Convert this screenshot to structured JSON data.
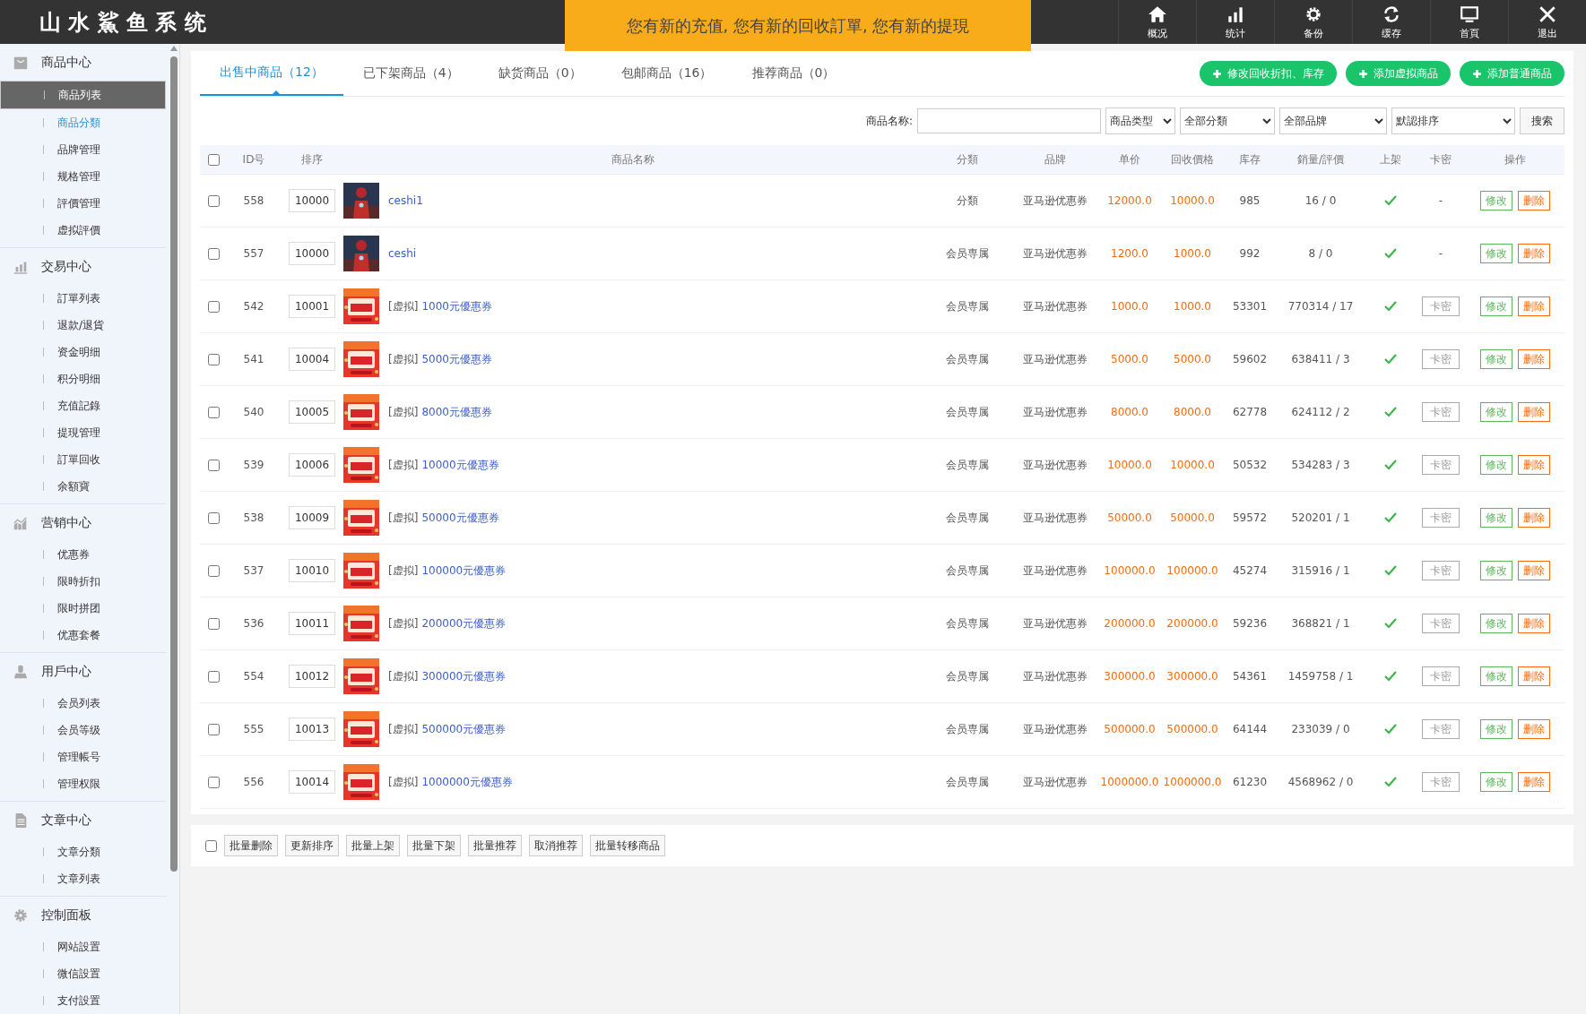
{
  "header": {
    "title": "山 水 鯊 鱼 系 统",
    "notice": "您有新的充值, 您有新的回收訂單, 您有新的提現",
    "nav": [
      "概况",
      "统计",
      "备份",
      "缓存",
      "首頁",
      "退出"
    ]
  },
  "sidebar": {
    "sections": [
      {
        "title": "商品中心",
        "items": [
          {
            "label": "商品列表",
            "selected": true,
            "highlighted": false
          },
          {
            "label": "商品分類",
            "selected": false,
            "highlighted": true
          },
          {
            "label": "品牌管理",
            "selected": false,
            "highlighted": false
          },
          {
            "label": "规格管理",
            "selected": false,
            "highlighted": false
          },
          {
            "label": "評價管理",
            "selected": false,
            "highlighted": false
          },
          {
            "label": "虚拟評價",
            "selected": false,
            "highlighted": false
          }
        ]
      },
      {
        "title": "交易中心",
        "items": [
          {
            "label": "訂單列表",
            "selected": false,
            "highlighted": false
          },
          {
            "label": "退款/退貨",
            "selected": false,
            "highlighted": false
          },
          {
            "label": "资金明细",
            "selected": false,
            "highlighted": false
          },
          {
            "label": "积分明细",
            "selected": false,
            "highlighted": false
          },
          {
            "label": "充值記錄",
            "selected": false,
            "highlighted": false
          },
          {
            "label": "提現管理",
            "selected": false,
            "highlighted": false
          },
          {
            "label": "訂單回收",
            "selected": false,
            "highlighted": false
          },
          {
            "label": "余額寶",
            "selected": false,
            "highlighted": false
          }
        ]
      },
      {
        "title": "营销中心",
        "items": [
          {
            "label": "优惠券",
            "selected": false,
            "highlighted": false
          },
          {
            "label": "限時折扣",
            "selected": false,
            "highlighted": false
          },
          {
            "label": "限时拼团",
            "selected": false,
            "highlighted": false
          },
          {
            "label": "优惠套餐",
            "selected": false,
            "highlighted": false
          }
        ]
      },
      {
        "title": "用戶中心",
        "items": [
          {
            "label": "会员列表",
            "selected": false,
            "highlighted": false
          },
          {
            "label": "会员等级",
            "selected": false,
            "highlighted": false
          },
          {
            "label": "管理帳号",
            "selected": false,
            "highlighted": false
          },
          {
            "label": "管理权限",
            "selected": false,
            "highlighted": false
          }
        ]
      },
      {
        "title": "文章中心",
        "items": [
          {
            "label": "文章分類",
            "selected": false,
            "highlighted": false
          },
          {
            "label": "文章列表",
            "selected": false,
            "highlighted": false
          }
        ]
      },
      {
        "title": "控制面板",
        "items": [
          {
            "label": "网站設置",
            "selected": false,
            "highlighted": false
          },
          {
            "label": "微信設置",
            "selected": false,
            "highlighted": false
          },
          {
            "label": "支付設置",
            "selected": false,
            "highlighted": false
          }
        ]
      }
    ]
  },
  "tabs": [
    {
      "label": "出售中商品（12）",
      "selected": true
    },
    {
      "label": "已下架商品（4）",
      "selected": false
    },
    {
      "label": "缺货商品（0）",
      "selected": false
    },
    {
      "label": "包邮商品（16）",
      "selected": false
    },
    {
      "label": "推荐商品（0）",
      "selected": false
    }
  ],
  "actions": [
    "修改回收折扣、库存",
    "添加虚拟商品",
    "添加普通商品"
  ],
  "filters": {
    "name_label": "商品名称:",
    "selects": [
      "商品类型",
      "全部分類",
      "全部品牌",
      "默認排序"
    ],
    "search": "搜索"
  },
  "table": {
    "select_all_checked": false,
    "columns": [
      "ID号",
      "排序",
      "商品名称",
      "分類",
      "品牌",
      "单价",
      "回收價格",
      "库存",
      "銷量/評價",
      "上架",
      "卡密",
      "操作"
    ],
    "rows": [
      {
        "checked": false,
        "id": "558",
        "sort": "10000",
        "name": "ceshi1",
        "category": "分類",
        "brand": "亚马逊优惠券",
        "price": "12000.0",
        "recycle": "10000.0",
        "stock": "985",
        "sales": "16 / 0",
        "on_shelf": true,
        "card": {
          "kind": "text",
          "label": "-"
        },
        "ops": [
          "修改",
          "删除"
        ]
      },
      {
        "checked": false,
        "id": "557",
        "sort": "10000",
        "name": "ceshi",
        "category": "会员専属",
        "brand": "亚马逊优惠券",
        "price": "1200.0",
        "recycle": "1000.0",
        "stock": "992",
        "sales": "8 / 0",
        "on_shelf": true,
        "card": {
          "kind": "text",
          "label": "-"
        },
        "ops": [
          "修改",
          "删除"
        ]
      },
      {
        "checked": false,
        "id": "542",
        "sort": "10001",
        "tag": "[虚拟]",
        "name": "1000元優惠券",
        "category": "会员専属",
        "brand": "亚马逊优惠券",
        "price": "1000.0",
        "recycle": "1000.0",
        "stock": "53301",
        "sales": "770314 / 17",
        "on_shelf": true,
        "card": {
          "kind": "button",
          "label": "卡密"
        },
        "ops": [
          "修改",
          "删除"
        ]
      },
      {
        "checked": false,
        "id": "541",
        "sort": "10004",
        "tag": "[虚拟]",
        "name": "5000元優惠券",
        "category": "会员専属",
        "brand": "亚马逊优惠券",
        "price": "5000.0",
        "recycle": "5000.0",
        "stock": "59602",
        "sales": "638411 / 3",
        "on_shelf": true,
        "card": {
          "kind": "button",
          "label": "卡密"
        },
        "ops": [
          "修改",
          "删除"
        ]
      },
      {
        "checked": false,
        "id": "540",
        "sort": "10005",
        "tag": "[虚拟]",
        "name": "8000元優惠券",
        "category": "会员専属",
        "brand": "亚马逊优惠券",
        "price": "8000.0",
        "recycle": "8000.0",
        "stock": "62778",
        "sales": "624112 / 2",
        "on_shelf": true,
        "card": {
          "kind": "button",
          "label": "卡密"
        },
        "ops": [
          "修改",
          "删除"
        ]
      },
      {
        "checked": false,
        "id": "539",
        "sort": "10006",
        "tag": "[虚拟]",
        "name": "10000元優惠券",
        "category": "会员専属",
        "brand": "亚马逊优惠券",
        "price": "10000.0",
        "recycle": "10000.0",
        "stock": "50532",
        "sales": "534283 / 3",
        "on_shelf": true,
        "card": {
          "kind": "button",
          "label": "卡密"
        },
        "ops": [
          "修改",
          "删除"
        ]
      },
      {
        "checked": false,
        "id": "538",
        "sort": "10009",
        "tag": "[虚拟]",
        "name": "50000元優惠券",
        "category": "会员専属",
        "brand": "亚马逊优惠券",
        "price": "50000.0",
        "recycle": "50000.0",
        "stock": "59572",
        "sales": "520201 / 1",
        "on_shelf": true,
        "card": {
          "kind": "button",
          "label": "卡密"
        },
        "ops": [
          "修改",
          "删除"
        ]
      },
      {
        "checked": false,
        "id": "537",
        "sort": "10010",
        "tag": "[虚拟]",
        "name": "100000元優惠券",
        "category": "会员専属",
        "brand": "亚马逊优惠券",
        "price": "100000.0",
        "recycle": "100000.0",
        "stock": "45274",
        "sales": "315916 / 1",
        "on_shelf": true,
        "card": {
          "kind": "button",
          "label": "卡密"
        },
        "ops": [
          "修改",
          "删除"
        ]
      },
      {
        "checked": false,
        "id": "536",
        "sort": "10011",
        "tag": "[虚拟]",
        "name": "200000元優惠券",
        "category": "会员専属",
        "brand": "亚马逊优惠券",
        "price": "200000.0",
        "recycle": "200000.0",
        "stock": "59236",
        "sales": "368821 / 1",
        "on_shelf": true,
        "card": {
          "kind": "button",
          "label": "卡密"
        },
        "ops": [
          "修改",
          "删除"
        ]
      },
      {
        "checked": false,
        "id": "554",
        "sort": "10012",
        "tag": "[虚拟]",
        "name": "300000元優惠券",
        "category": "会员専属",
        "brand": "亚马逊优惠券",
        "price": "300000.0",
        "recycle": "300000.0",
        "stock": "54361",
        "sales": "1459758 / 1",
        "on_shelf": true,
        "card": {
          "kind": "button",
          "label": "卡密"
        },
        "ops": [
          "修改",
          "删除"
        ]
      },
      {
        "checked": false,
        "id": "555",
        "sort": "10013",
        "tag": "[虚拟]",
        "name": "500000元優惠券",
        "category": "会员専属",
        "brand": "亚马逊优惠券",
        "price": "500000.0",
        "recycle": "500000.0",
        "stock": "64144",
        "sales": "233039 / 0",
        "on_shelf": true,
        "card": {
          "kind": "button",
          "label": "卡密"
        },
        "ops": [
          "修改",
          "删除"
        ]
      },
      {
        "checked": false,
        "id": "556",
        "sort": "10014",
        "tag": "[虚拟]",
        "name": "1000000元優惠券",
        "category": "会员専属",
        "brand": "亚马逊优惠券",
        "price": "1000000.0",
        "recycle": "1000000.0",
        "stock": "61230",
        "sales": "4568962 / 0",
        "on_shelf": true,
        "card": {
          "kind": "button",
          "label": "卡密"
        },
        "ops": [
          "修改",
          "删除"
        ]
      }
    ]
  },
  "bulk": {
    "checked": false,
    "buttons": [
      "批量删除",
      "更新排序",
      "批量上架",
      "批量下架",
      "批量推荐",
      "取消推荐",
      "批量转移商品"
    ]
  }
}
